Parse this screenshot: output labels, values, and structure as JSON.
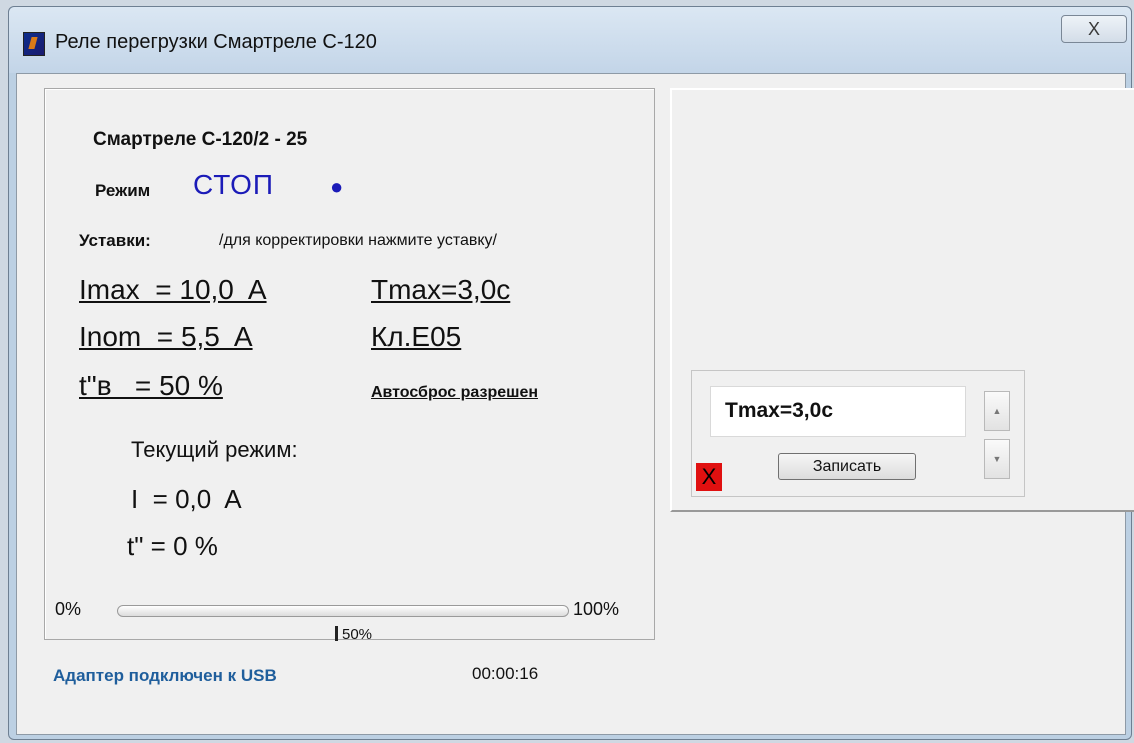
{
  "window": {
    "title": "Реле перегрузки Смартреле С-120",
    "close_symbol": "X",
    "app_icon": "relay-app-icon"
  },
  "device": {
    "name": "Смартреле С-120/2 - 25"
  },
  "mode": {
    "label": "Режим",
    "value": "СТОП",
    "indicator": "●",
    "value_color": "#1b1bb8"
  },
  "settings": {
    "label": "Уставки:",
    "hint": "/для корректировки нажмите уставку/",
    "imax": "Imax  = 10,0  A",
    "tmax": "Tmax=3,0с",
    "inom": "Inom  = 5,5  A",
    "class": "Кл.Е05",
    "tv": "t\"в   = 50 %",
    "autoreset": "Автосброс разрешен"
  },
  "current": {
    "title": "Текущий режим:",
    "i": "I  = 0,0  A",
    "t": "t\" = 0 %"
  },
  "progress": {
    "min_label": "0%",
    "max_label": "100%",
    "mark_label": "50%",
    "value": 0,
    "fill_color": "#3bb24a"
  },
  "status": {
    "connection": "Адаптер подключен к USB",
    "timer": "00:00:16",
    "connection_color": "#1f5e9c"
  },
  "editor": {
    "value": "Tmax=3,0с",
    "write_label": "Записать",
    "cancel_symbol": "X",
    "spin_up_symbol": "▲",
    "spin_down_symbol": "▼"
  }
}
